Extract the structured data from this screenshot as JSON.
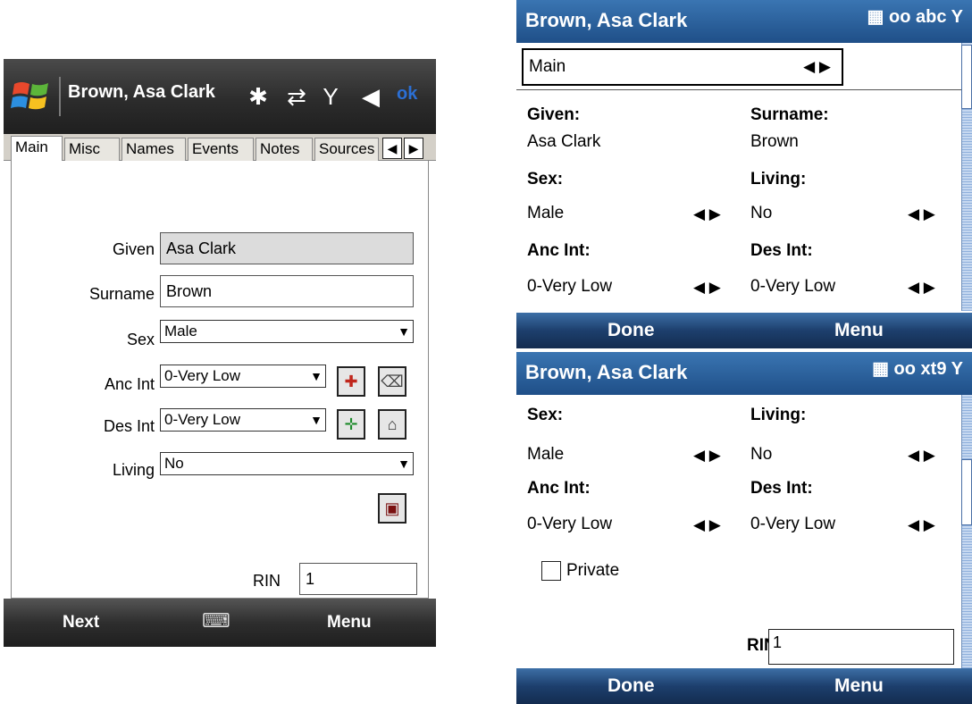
{
  "touch": {
    "title": "Brown, Asa Clark",
    "ok": "ok",
    "status_icons": [
      "bluetooth-icon",
      "sync-arrows-icon",
      "signal-icon",
      "speaker-icon"
    ],
    "tabs": [
      "Main",
      "Misc",
      "Names",
      "Events",
      "Notes",
      "Sources"
    ],
    "active_tab": "Main",
    "fields": {
      "given_label": "Given",
      "given_value": "Asa Clark",
      "surname_label": "Surname",
      "surname_value": "Brown",
      "sex_label": "Sex",
      "sex_value": "Male",
      "anc_label": "Anc Int",
      "anc_value": "0-Very Low",
      "des_label": "Des Int",
      "des_value": "0-Very Low",
      "living_label": "Living",
      "living_value": "No",
      "rin_label": "RIN",
      "rin_value": "1"
    },
    "softkeys": {
      "left": "Next",
      "right": "Menu"
    }
  },
  "smart1": {
    "title": "Brown, Asa Clark",
    "input_mode": "abc",
    "combo": "Main",
    "given_label": "Given:",
    "given_value": "Asa Clark",
    "surname_label": "Surname:",
    "surname_value": "Brown",
    "sex_label": "Sex:",
    "sex_value": "Male",
    "living_label": "Living:",
    "living_value": "No",
    "anc_label": "Anc Int:",
    "anc_value": "0-Very Low",
    "des_label": "Des Int:",
    "des_value": "0-Very Low",
    "softkeys": {
      "left": "Done",
      "right": "Menu"
    }
  },
  "smart2": {
    "title": "Brown, Asa Clark",
    "input_mode": "xt9",
    "sex_label": "Sex:",
    "sex_value": "Male",
    "living_label": "Living:",
    "living_value": "No",
    "anc_label": "Anc Int:",
    "anc_value": "0-Very Low",
    "des_label": "Des Int:",
    "des_value": "0-Very Low",
    "private_label": "Private",
    "private_checked": false,
    "rin_label": "RIN",
    "rin_value": "1",
    "softkeys": {
      "left": "Done",
      "right": "Menu"
    }
  },
  "colors": {
    "touch_titlebar": "#2c2c2c",
    "ok_blue": "#2b6fd4",
    "smart_blue": "#1f4f88"
  }
}
